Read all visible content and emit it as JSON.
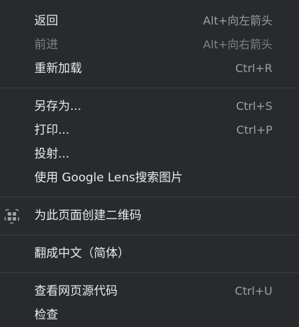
{
  "menu": {
    "groups": [
      {
        "items": [
          {
            "label": "返回",
            "shortcut": "Alt+向左箭头"
          },
          {
            "label": "前进",
            "shortcut": "Alt+向右箭头"
          },
          {
            "label": "重新加载",
            "shortcut": "Ctrl+R"
          }
        ]
      },
      {
        "items": [
          {
            "label": "另存为...",
            "shortcut": "Ctrl+S"
          },
          {
            "label": "打印...",
            "shortcut": "Ctrl+P"
          },
          {
            "label": "投射..."
          },
          {
            "label": "使用 Google Lens搜索图片"
          }
        ]
      },
      {
        "items": [
          {
            "label": "为此页面创建二维码",
            "icon": "qr-code-icon"
          }
        ]
      },
      {
        "items": [
          {
            "label": "翻成中文（简体）"
          }
        ]
      },
      {
        "items": [
          {
            "label": "查看网页源代码",
            "shortcut": "Ctrl+U"
          },
          {
            "label": "检查"
          }
        ]
      }
    ]
  },
  "colors": {
    "background": "#292a2d",
    "text": "#e8eaed",
    "shortcut_text": "#9aa0a6",
    "disabled_text": "#7f8186",
    "separator": "#3c3d41"
  }
}
